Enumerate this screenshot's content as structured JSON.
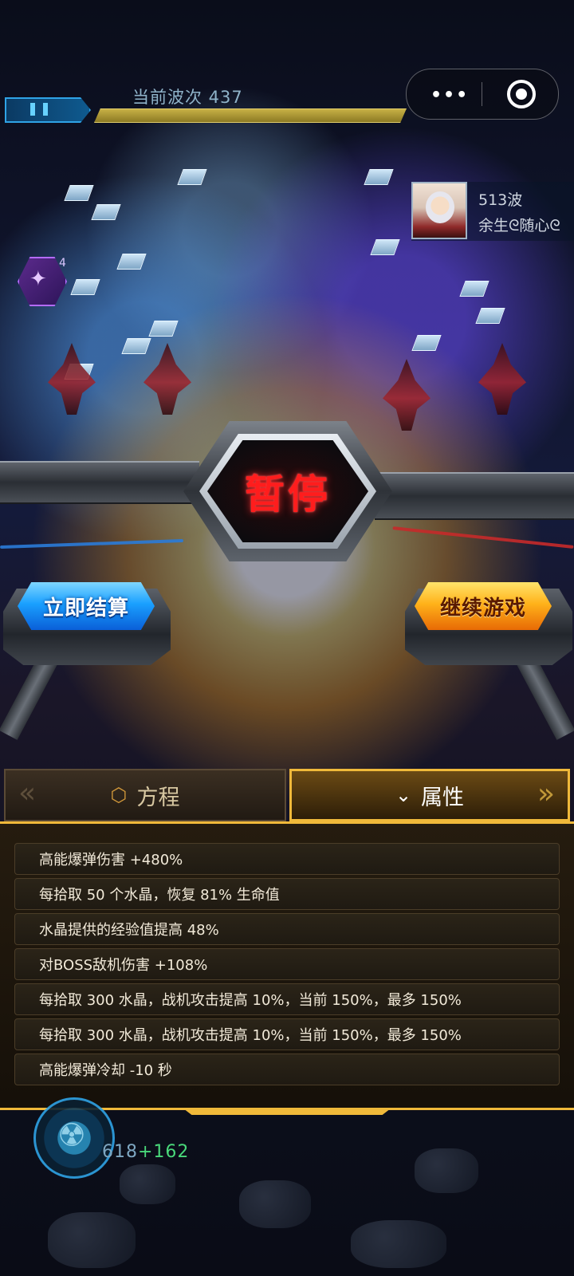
{
  "hud": {
    "wave_label": "当前波次 437",
    "capsule_menu": "•••"
  },
  "rival": {
    "wave": "513波",
    "name": "余生ᘓ随心ᘓ"
  },
  "skill_badge": {
    "count": "4"
  },
  "pause": {
    "title": "暂停"
  },
  "buttons": {
    "settle": "立即结算",
    "continue": "继续游戏"
  },
  "tabs": {
    "formula": "方程",
    "attributes": "属性",
    "active": "attributes"
  },
  "attributes": [
    "高能爆弹伤害 +480%",
    "每拾取 50 个水晶，恢复 81% 生命值",
    "水晶提供的经验值提高 48%",
    "对BOSS敌机伤害 +108%",
    "每拾取 300 水晶，战机攻击提高 10%，当前 150%，最多 150%",
    "每拾取 300 水晶，战机攻击提高 10%，当前 150%，最多 150%",
    "高能爆弹冷却 -10 秒"
  ],
  "bottom_hud": {
    "score": "618",
    "bonus": "+162"
  },
  "colors": {
    "gold_accent": "#f0b93a",
    "pause_red": "#ff1d1d",
    "blue_button": "#1aa0ff",
    "orange_button": "#ffb21a"
  }
}
